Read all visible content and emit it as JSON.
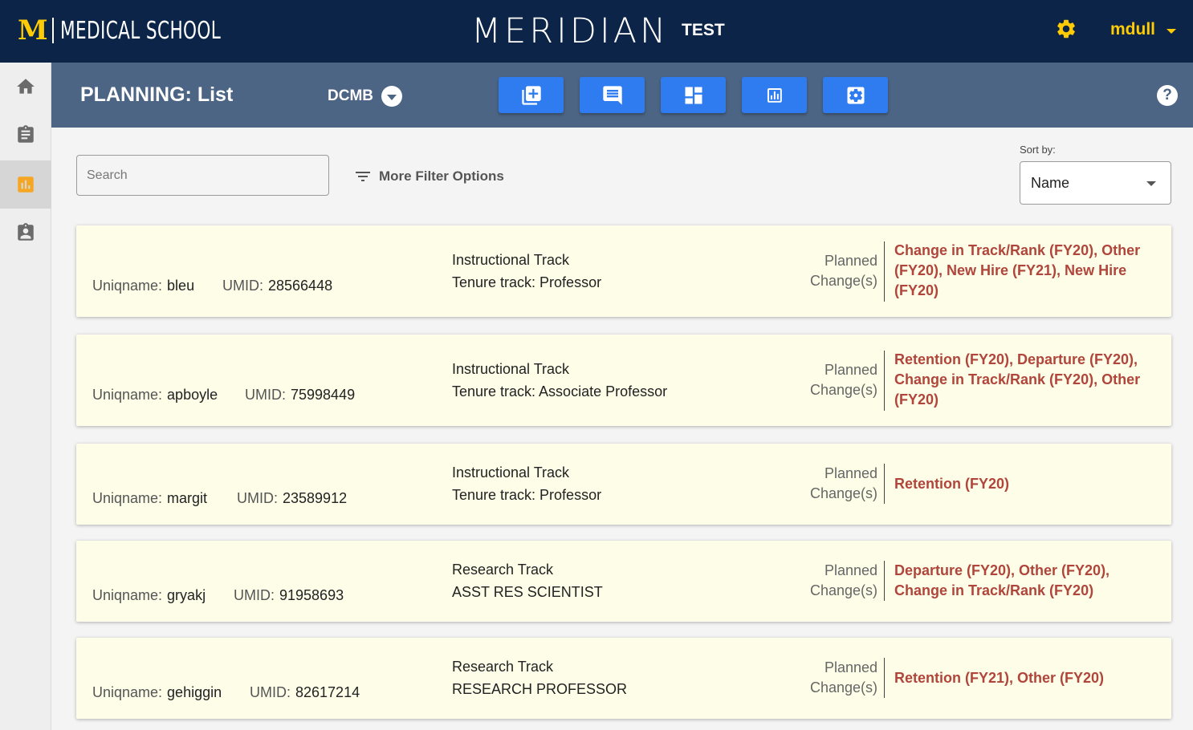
{
  "header": {
    "logo_mark": "M",
    "logo_text": "MEDICAL SCHOOL",
    "app_name": "MERIDIAN",
    "env_label": "TEST",
    "username": "mdull",
    "accent_color": "#ffcb05",
    "bg_color": "#0b2447"
  },
  "sidebar": {
    "items": [
      {
        "icon": "home-icon"
      },
      {
        "icon": "clipboard-icon"
      },
      {
        "icon": "chart-icon",
        "active": true
      },
      {
        "icon": "badge-icon"
      }
    ]
  },
  "subheader": {
    "title": "PLANNING: List",
    "department": "DCMB",
    "tools": [
      "add-box-icon",
      "comment-icon",
      "dashboard-icon",
      "report-icon",
      "settings-box-icon"
    ],
    "help": "?"
  },
  "filters": {
    "search_placeholder": "Search",
    "more_filters_label": "More Filter Options",
    "sort_label": "Sort by:",
    "sort_value": "Name"
  },
  "labels": {
    "uniqname": "Uniqname:",
    "umid": "UMID:",
    "planned": "Planned",
    "changes": "Change(s)"
  },
  "records": [
    {
      "uniqname": "bleu",
      "umid": "28566448",
      "track": "Instructional Track",
      "rank": "Tenure track: Professor",
      "changes": "Change in Track/Rank (FY20), Other (FY20), New Hire (FY21), New Hire (FY20)"
    },
    {
      "uniqname": "apboyle",
      "umid": "75998449",
      "track": "Instructional Track",
      "rank": "Tenure track: Associate Professor",
      "changes": "Retention (FY20), Departure (FY20), Change in Track/Rank (FY20), Other (FY20)"
    },
    {
      "uniqname": "margit",
      "umid": "23589912",
      "track": "Instructional Track",
      "rank": "Tenure track: Professor",
      "changes": "Retention (FY20)"
    },
    {
      "uniqname": "gryakj",
      "umid": "91958693",
      "track": "Research Track",
      "rank": "ASST RES SCIENTIST",
      "changes": "Departure (FY20), Other (FY20), Change in Track/Rank (FY20)"
    },
    {
      "uniqname": "gehiggin",
      "umid": "82617214",
      "track": "Research Track",
      "rank": "RESEARCH PROFESSOR",
      "changes": "Retention (FY21), Other (FY20)"
    }
  ]
}
